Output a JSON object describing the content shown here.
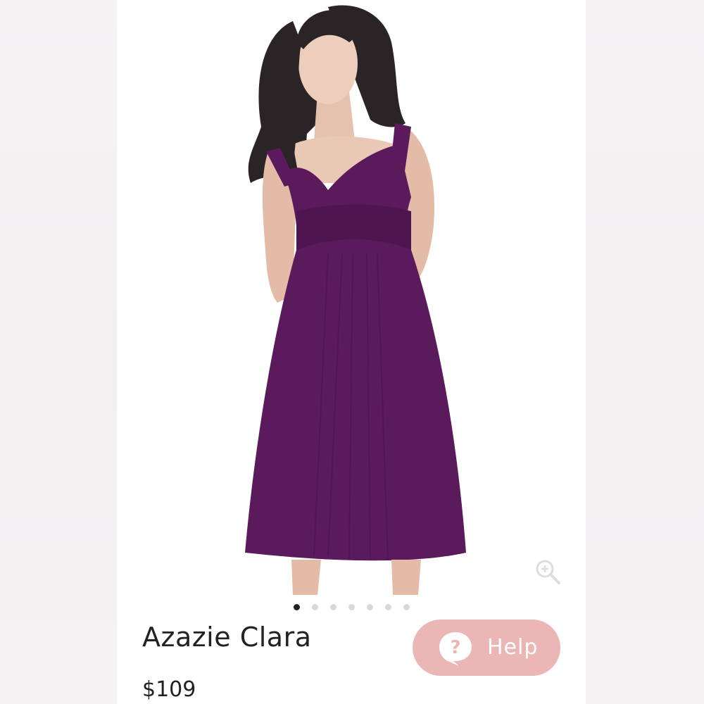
{
  "product": {
    "name": "Azazie Clara",
    "price": "$109"
  },
  "gallery": {
    "image_count": 7,
    "active_index": 0,
    "dress_color": "#5a1a5c"
  },
  "help_button": {
    "label": "Help",
    "icon": "question-bubble-icon",
    "color": "#ebb6b6"
  },
  "zoom_icon": "zoom-in-icon"
}
